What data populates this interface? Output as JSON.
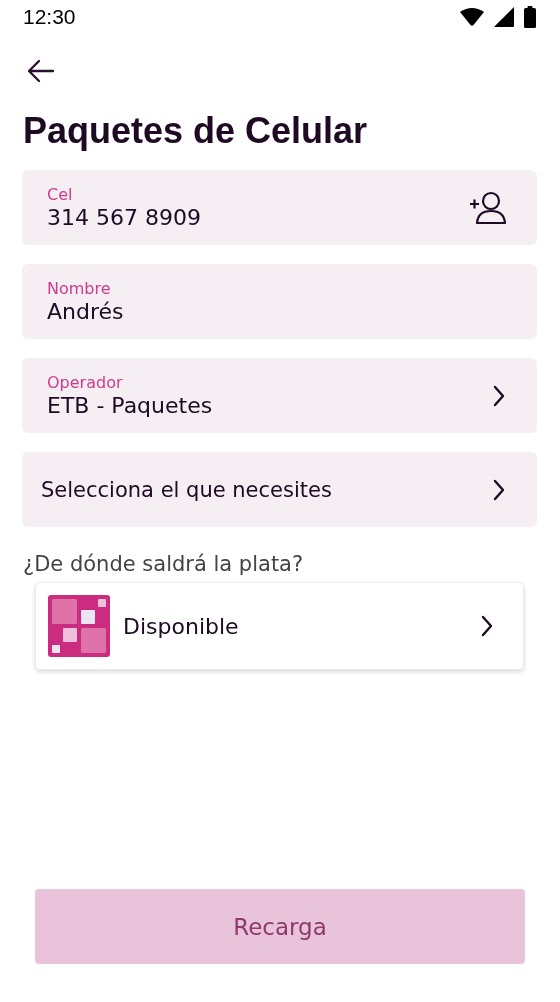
{
  "status_bar": {
    "time": "12:30"
  },
  "title": "Paquetes de Celular",
  "fields": [
    {
      "kind": "contact",
      "label": "Cel",
      "value": "314 567 8909"
    },
    {
      "kind": "text",
      "label": "Nombre",
      "value": "Andrés"
    },
    {
      "kind": "select",
      "label": "Operador",
      "value": "ETB - Paquetes"
    },
    {
      "kind": "choice",
      "value": "Selecciona el que necesites"
    }
  ],
  "source": {
    "question": "¿De dónde saldrá la plata?",
    "account": "Disponible"
  },
  "submit": {
    "label": "Recarga",
    "disabled": true
  }
}
